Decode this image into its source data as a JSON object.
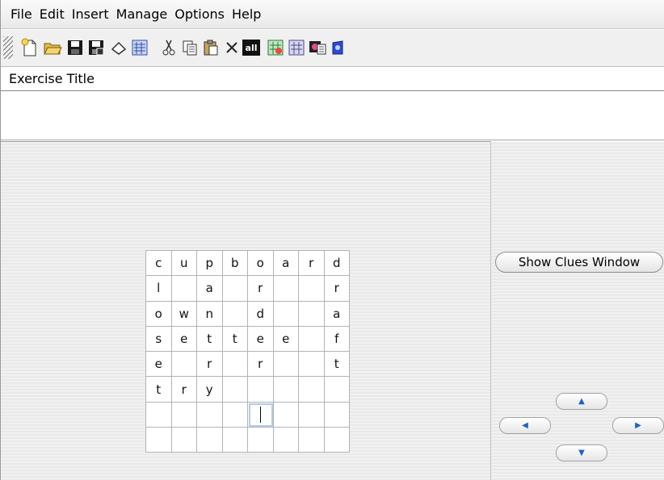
{
  "menubar": {
    "items": [
      "File",
      "Edit",
      "Insert",
      "Manage",
      "Options",
      "Help"
    ]
  },
  "toolbar": {
    "buttons": [
      "new-icon",
      "open-icon",
      "save-icon",
      "save-as-icon",
      "eraser-icon",
      "web-export-icon",
      "cut-icon",
      "copy-icon",
      "paste-icon",
      "delete-icon",
      "select-all-icon",
      "check-icon",
      "settings-icon",
      "preview-icon",
      "publish-icon"
    ],
    "select_all_label": "all"
  },
  "exercise": {
    "title_label": "Exercise Title",
    "title_value": ""
  },
  "grid": {
    "rows": [
      [
        "c",
        "u",
        "p",
        "b",
        "o",
        "a",
        "r",
        "d"
      ],
      [
        "l",
        "",
        "a",
        "",
        "r",
        "",
        "",
        "r"
      ],
      [
        "o",
        "w",
        "n",
        "",
        "d",
        "",
        "",
        "a"
      ],
      [
        "s",
        "e",
        "t",
        "t",
        "e",
        "e",
        "",
        "f"
      ],
      [
        "e",
        "",
        "r",
        "",
        "r",
        "",
        "",
        "t"
      ],
      [
        "t",
        "r",
        "y",
        "",
        "",
        "",
        "",
        ""
      ],
      [
        "",
        "",
        "",
        "",
        "",
        "",
        "",
        ""
      ],
      [
        "",
        "",
        "",
        "",
        "",
        "",
        "",
        ""
      ]
    ],
    "active_row": 6,
    "active_col": 4
  },
  "side": {
    "show_clues_label": "Show Clues Window",
    "arrows": {
      "up": "▲",
      "left": "◀",
      "right": "▶",
      "down": "▼"
    }
  }
}
